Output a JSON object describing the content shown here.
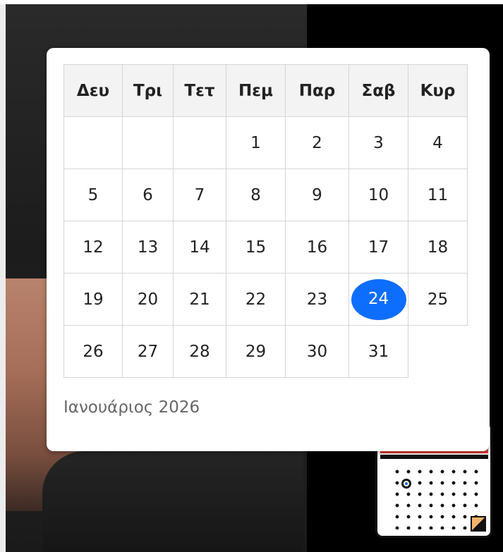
{
  "calendar": {
    "weekdays": [
      "Δευ",
      "Τρι",
      "Τετ",
      "Πεμ",
      "Παρ",
      "Σαβ",
      "Κυρ"
    ],
    "weeks": [
      [
        "",
        "",
        "",
        "1",
        "2",
        "3",
        "4"
      ],
      [
        "5",
        "6",
        "7",
        "8",
        "9",
        "10",
        "11"
      ],
      [
        "12",
        "13",
        "14",
        "15",
        "16",
        "17",
        "18"
      ],
      [
        "19",
        "20",
        "21",
        "22",
        "23",
        "24",
        "25"
      ],
      [
        "26",
        "27",
        "28",
        "29",
        "30",
        "31",
        ""
      ]
    ],
    "selected_day": "24",
    "month_label": "Ιανουάριος 2026",
    "selected_color": "#0d6efd"
  },
  "icons": {
    "background_calendar": "calendar-icon"
  }
}
